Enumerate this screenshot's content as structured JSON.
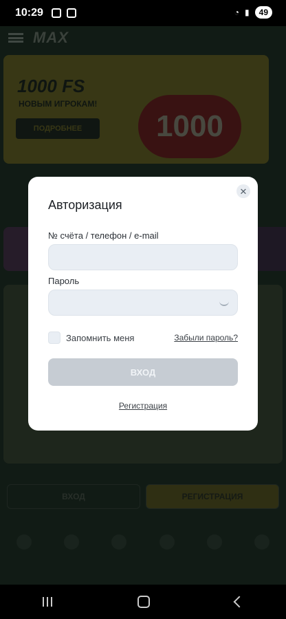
{
  "status_bar": {
    "time": "10:29",
    "battery": "49"
  },
  "background_app": {
    "logo": "MAX",
    "banner": {
      "title": "1000 FS",
      "subtitle": "НОВЫМ ИГРОКАМ!",
      "button": "ПОДРОБНЕЕ",
      "big_text": "1000"
    },
    "bottom_buttons": {
      "login": "ВХОД",
      "register": "РЕГИСТРАЦИЯ"
    }
  },
  "modal": {
    "title": "Авторизация",
    "close_icon": "close-icon",
    "account_label": "№ счёта / телефон / e-mail",
    "account_value": "",
    "password_label": "Пароль",
    "password_value": "",
    "remember_label": "Запомнить меня",
    "forgot_link": "Забыли пароль?",
    "login_button": "ВХОД",
    "register_link": "Регистрация"
  }
}
